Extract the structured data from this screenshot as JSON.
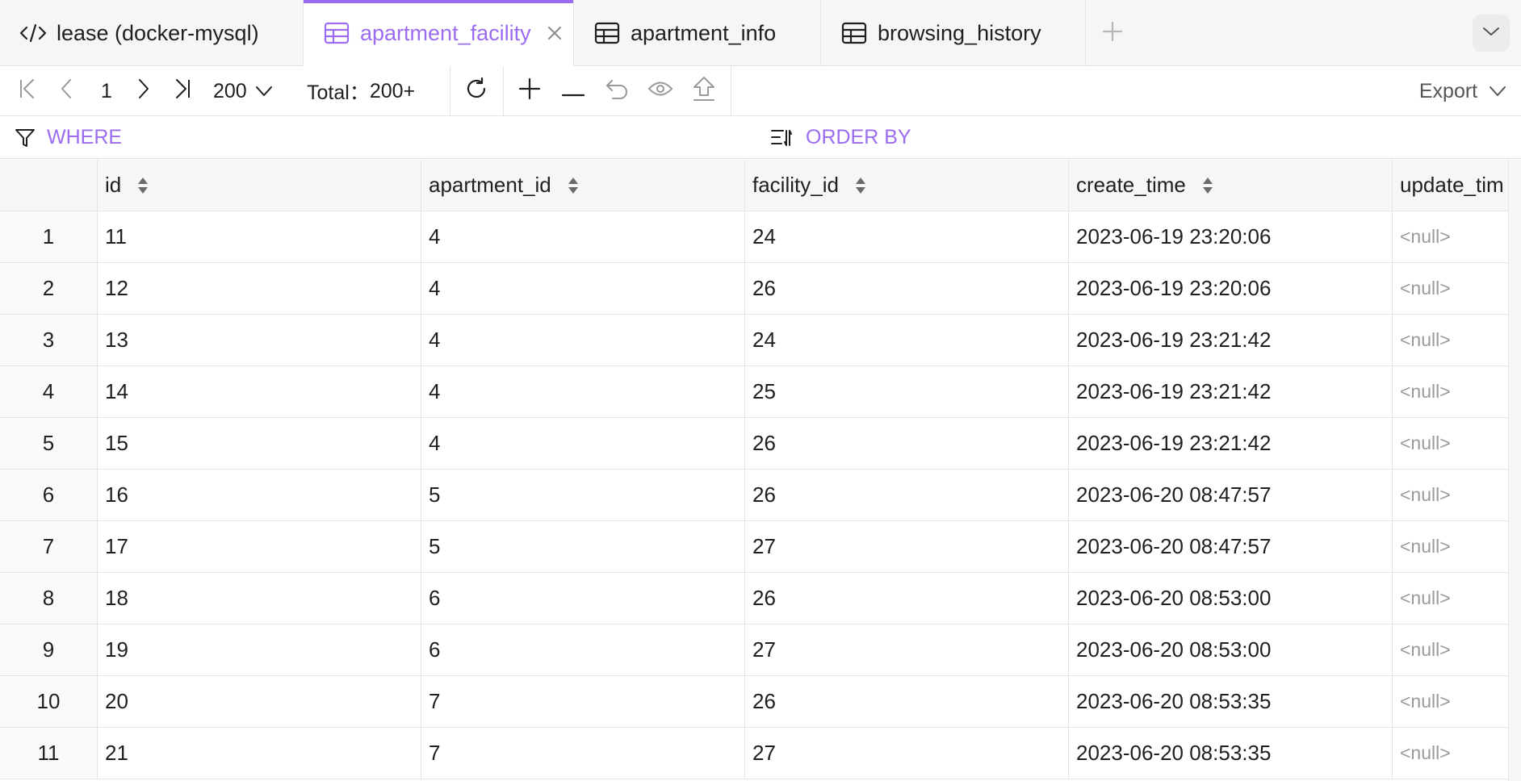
{
  "tabs": [
    {
      "label": "lease (docker-mysql)",
      "icon": "code-icon",
      "active": false
    },
    {
      "label": "apartment_facility",
      "icon": "table-icon",
      "active": true
    },
    {
      "label": "apartment_info",
      "icon": "table-icon",
      "active": false
    },
    {
      "label": "browsing_history",
      "icon": "table-icon",
      "active": false
    }
  ],
  "toolbar": {
    "page": "1",
    "page_size": "200",
    "total_label": "Total：",
    "total_value": "200+",
    "export_label": "Export"
  },
  "filters": {
    "where_label": "WHERE",
    "order_label": "ORDER BY"
  },
  "colors": {
    "accent": "#9b6cf0",
    "null_text": "#9a9a9a",
    "border": "#e4e4e7"
  },
  "table": {
    "columns": [
      "id",
      "apartment_id",
      "facility_id",
      "create_time",
      "update_tim"
    ],
    "rows": [
      {
        "n": "1",
        "id": "11",
        "apartment_id": "4",
        "facility_id": "24",
        "create_time": "2023-06-19 23:20:06",
        "update_time": "<null>"
      },
      {
        "n": "2",
        "id": "12",
        "apartment_id": "4",
        "facility_id": "26",
        "create_time": "2023-06-19 23:20:06",
        "update_time": "<null>"
      },
      {
        "n": "3",
        "id": "13",
        "apartment_id": "4",
        "facility_id": "24",
        "create_time": "2023-06-19 23:21:42",
        "update_time": "<null>"
      },
      {
        "n": "4",
        "id": "14",
        "apartment_id": "4",
        "facility_id": "25",
        "create_time": "2023-06-19 23:21:42",
        "update_time": "<null>"
      },
      {
        "n": "5",
        "id": "15",
        "apartment_id": "4",
        "facility_id": "26",
        "create_time": "2023-06-19 23:21:42",
        "update_time": "<null>"
      },
      {
        "n": "6",
        "id": "16",
        "apartment_id": "5",
        "facility_id": "26",
        "create_time": "2023-06-20 08:47:57",
        "update_time": "<null>"
      },
      {
        "n": "7",
        "id": "17",
        "apartment_id": "5",
        "facility_id": "27",
        "create_time": "2023-06-20 08:47:57",
        "update_time": "<null>"
      },
      {
        "n": "8",
        "id": "18",
        "apartment_id": "6",
        "facility_id": "26",
        "create_time": "2023-06-20 08:53:00",
        "update_time": "<null>"
      },
      {
        "n": "9",
        "id": "19",
        "apartment_id": "6",
        "facility_id": "27",
        "create_time": "2023-06-20 08:53:00",
        "update_time": "<null>"
      },
      {
        "n": "10",
        "id": "20",
        "apartment_id": "7",
        "facility_id": "26",
        "create_time": "2023-06-20 08:53:35",
        "update_time": "<null>"
      },
      {
        "n": "11",
        "id": "21",
        "apartment_id": "7",
        "facility_id": "27",
        "create_time": "2023-06-20 08:53:35",
        "update_time": "<null>"
      }
    ]
  }
}
